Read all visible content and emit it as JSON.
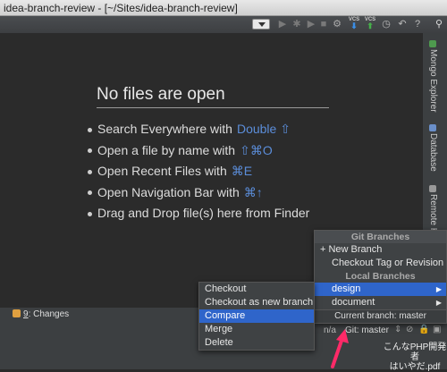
{
  "window": {
    "title": "idea-branch-review - [~/Sites/idea-branch-review]"
  },
  "toolbar": {
    "vcs_label": "VCS",
    "icons": [
      "run-icon",
      "debug-icon",
      "coverage-icon",
      "stop-icon",
      "settings-icon",
      "vcs-update-icon",
      "vcs-commit-icon",
      "history-icon",
      "undo-icon",
      "help-icon",
      "search-icon"
    ]
  },
  "editor": {
    "no_files_title": "No files are open",
    "hints": [
      {
        "text": "Search Everywhere with",
        "key": "Double ⇧"
      },
      {
        "text": "Open a file by name with",
        "key": "⇧⌘O"
      },
      {
        "text": "Open Recent Files with",
        "key": "⌘E"
      },
      {
        "text": "Open Navigation Bar with",
        "key": "⌘↑"
      },
      {
        "text": "Drag and Drop file(s) here from Finder",
        "key": ""
      }
    ],
    "key_color": "#5b8dd9"
  },
  "right_strip": {
    "tabs": [
      "Mongo Explorer",
      "Database",
      "Remote H"
    ]
  },
  "bottom_bar": {
    "changes_number": "9",
    "changes_label": ": Changes"
  },
  "status_bar": {
    "na": "n/a",
    "git": "Git: master"
  },
  "git_branches_popup": {
    "title": "Git Branches",
    "new_branch": "+ New Branch",
    "checkout_tag": "Checkout Tag or Revision",
    "local_header": "Local Branches",
    "branches": [
      "design",
      "document"
    ],
    "current_branch": "Current branch: master"
  },
  "branch_submenu": {
    "items": [
      "Checkout",
      "Checkout as new branch",
      "Compare",
      "Merge",
      "Delete"
    ],
    "selected": "Compare"
  },
  "watermark": {
    "line1": "こんなPHP開発者",
    "line2": "はいやだ.pdf"
  },
  "colors": {
    "selection": "#2f65ca",
    "arrow": "#ff2a68"
  }
}
